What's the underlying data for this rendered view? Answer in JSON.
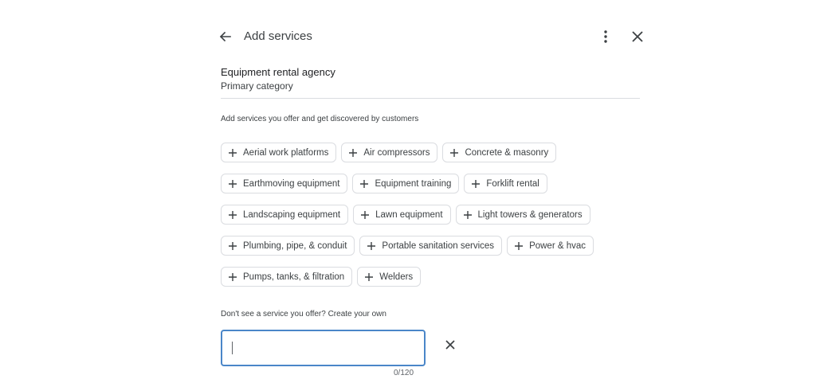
{
  "header": {
    "title": "Add services",
    "back_icon": "arrow-left-icon",
    "more_icon": "more-vert-icon",
    "close_icon": "close-icon"
  },
  "category": {
    "name": "Equipment rental agency",
    "label": "Primary category"
  },
  "intro_text": "Add services you offer and get discovered by customers",
  "services": {
    "rows": [
      [
        "Aerial work platforms",
        "Air compressors",
        "Concrete & masonry"
      ],
      [
        "Earthmoving equipment",
        "Equipment training",
        "Forklift rental"
      ],
      [
        "Landscaping equipment",
        "Lawn equipment",
        "Light towers & generators"
      ],
      [
        "Plumbing, pipe, & conduit",
        "Portable sanitation services",
        "Power & hvac"
      ],
      [
        "Pumps, tanks, & filtration",
        "Welders"
      ]
    ],
    "chip_icon": "plus-icon"
  },
  "custom": {
    "label": "Don't see a service you offer? Create your own",
    "value": "",
    "counter": "0/120",
    "clear_icon": "close-icon",
    "accent": "#4a86c8"
  }
}
